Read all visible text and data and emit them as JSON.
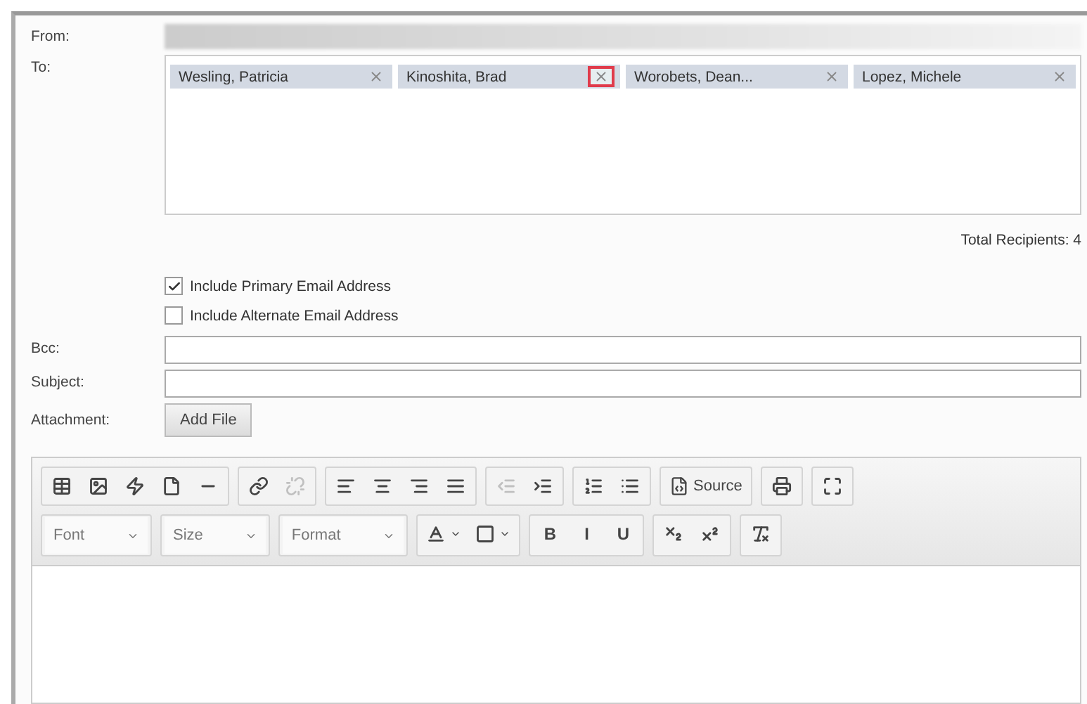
{
  "form": {
    "from_label": "From:",
    "to_label": "To:",
    "recipients": [
      {
        "name": "Wesling, Patricia",
        "highlighted": false
      },
      {
        "name": "Kinoshita, Brad",
        "highlighted": true
      },
      {
        "name": "Worobets, Dean...",
        "highlighted": false
      },
      {
        "name": "Lopez, Michele",
        "highlighted": false
      }
    ],
    "total_recipients": "Total Recipients: 4",
    "options": [
      {
        "label": "Include Primary Email Address",
        "checked": true
      },
      {
        "label": "Include Alternate Email Address",
        "checked": false
      }
    ],
    "bcc_label": "Bcc:",
    "subject_label": "Subject:",
    "attachment_label": "Attachment:",
    "add_file_button": "Add File"
  },
  "editor": {
    "toolbar_rows": [
      [
        [
          {
            "kind": "table",
            "disabled": false
          },
          {
            "kind": "image",
            "disabled": false
          },
          {
            "kind": "flash",
            "disabled": false
          },
          {
            "kind": "page",
            "disabled": false
          },
          {
            "kind": "rule",
            "disabled": false
          }
        ],
        [
          {
            "kind": "link",
            "disabled": false
          },
          {
            "kind": "unlink",
            "disabled": true
          }
        ],
        [
          {
            "kind": "align-left",
            "disabled": false
          },
          {
            "kind": "align-center",
            "disabled": false
          },
          {
            "kind": "align-right",
            "disabled": false
          },
          {
            "kind": "justify",
            "disabled": false
          }
        ],
        [
          {
            "kind": "outdent",
            "disabled": true
          },
          {
            "kind": "indent",
            "disabled": false
          }
        ],
        [
          {
            "kind": "numbered-list",
            "disabled": false
          },
          {
            "kind": "bulleted-list",
            "disabled": false
          }
        ],
        [
          {
            "kind": "source",
            "label": "Source",
            "disabled": false
          }
        ],
        [
          {
            "kind": "print",
            "disabled": false
          }
        ],
        [
          {
            "kind": "maximize",
            "disabled": false
          }
        ]
      ],
      [
        [
          {
            "kind": "combo",
            "label": "Font"
          }
        ],
        [
          {
            "kind": "combo",
            "label": "Size"
          }
        ],
        [
          {
            "kind": "combo",
            "label": "Format"
          }
        ],
        [
          {
            "kind": "text-color",
            "disabled": false
          },
          {
            "kind": "background-color",
            "disabled": false
          }
        ],
        [
          {
            "kind": "text",
            "label": "B",
            "disabled": false
          },
          {
            "kind": "text",
            "label": "I",
            "disabled": false
          },
          {
            "kind": "text",
            "label": "U",
            "disabled": false
          }
        ],
        [
          {
            "kind": "subscript",
            "disabled": false
          },
          {
            "kind": "superscript",
            "disabled": false
          }
        ],
        [
          {
            "kind": "remove-format",
            "disabled": false
          }
        ]
      ]
    ]
  }
}
